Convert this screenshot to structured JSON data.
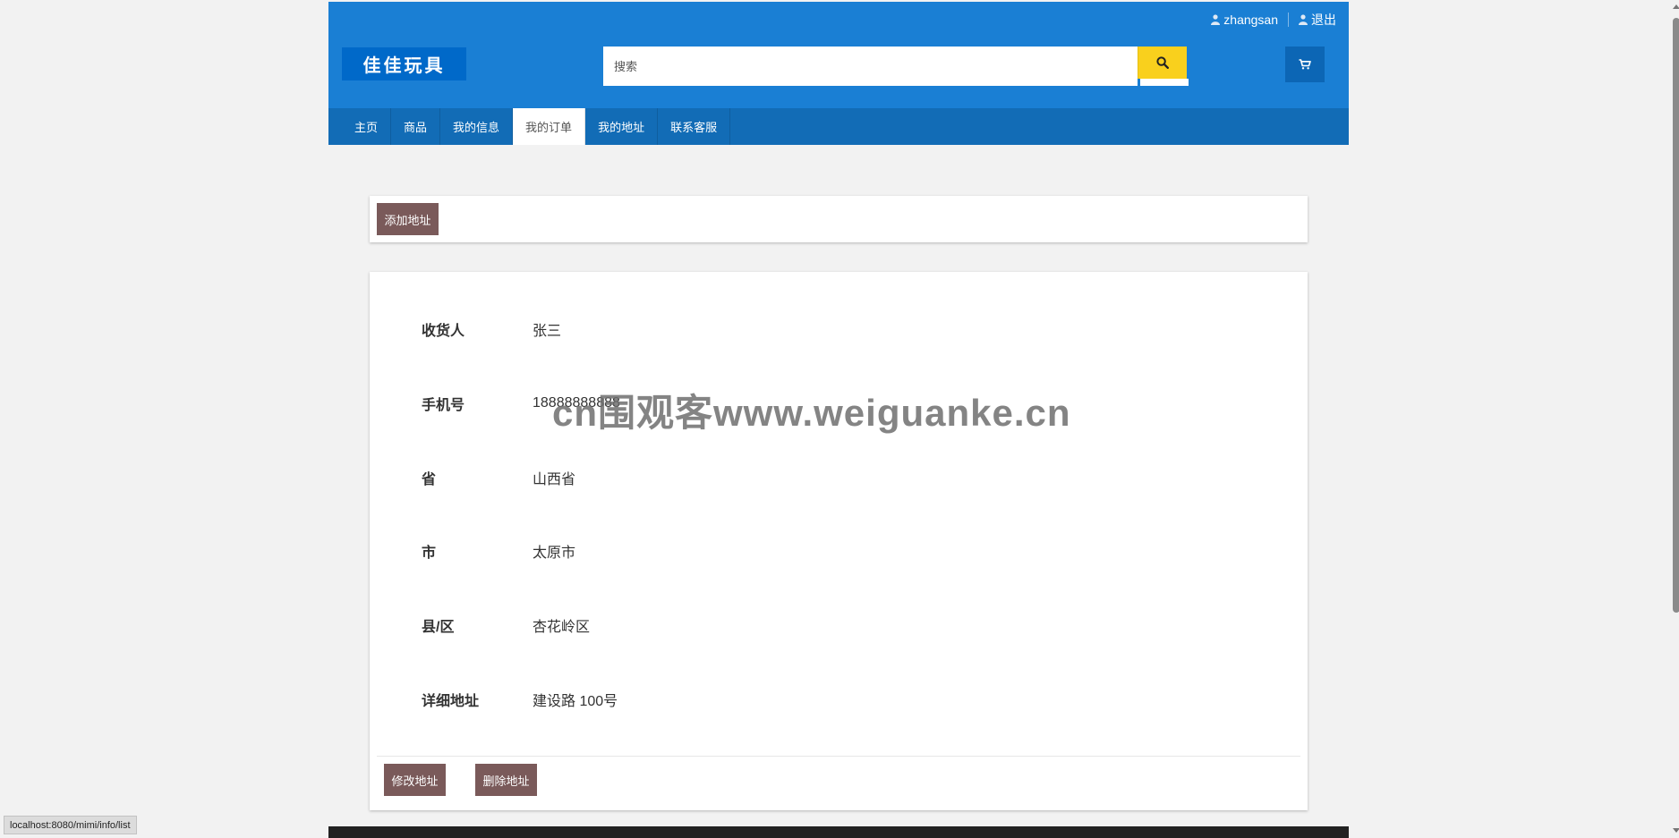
{
  "header": {
    "username": "zhangsan",
    "logout_label": "退出",
    "logo_text": "佳佳玩具",
    "search_placeholder": "搜索",
    "accent_color": "#1a7fd4",
    "search_button_color": "#f9d01d"
  },
  "nav": {
    "items": [
      {
        "label": "主页"
      },
      {
        "label": "商品"
      },
      {
        "label": "我的信息"
      },
      {
        "label": "我的订单",
        "active": true
      },
      {
        "label": "我的地址"
      },
      {
        "label": "联系客服"
      }
    ]
  },
  "toolbar": {
    "add_address_label": "添加地址"
  },
  "address": {
    "fields": [
      {
        "label": "收货人",
        "value": "张三"
      },
      {
        "label": "手机号",
        "value": "18888888888"
      },
      {
        "label": "省",
        "value": "山西省"
      },
      {
        "label": "市",
        "value": "太原市"
      },
      {
        "label": "县/区",
        "value": "杏花岭区"
      },
      {
        "label": "详细地址",
        "value": "建设路 100号"
      }
    ],
    "edit_label": "修改地址",
    "delete_label": "删除地址",
    "button_color": "#7a5a5a"
  },
  "watermark": "cn围观客www.weiguanke.cn",
  "status_bar": {
    "url": "localhost:8080/mimi/info/list"
  }
}
